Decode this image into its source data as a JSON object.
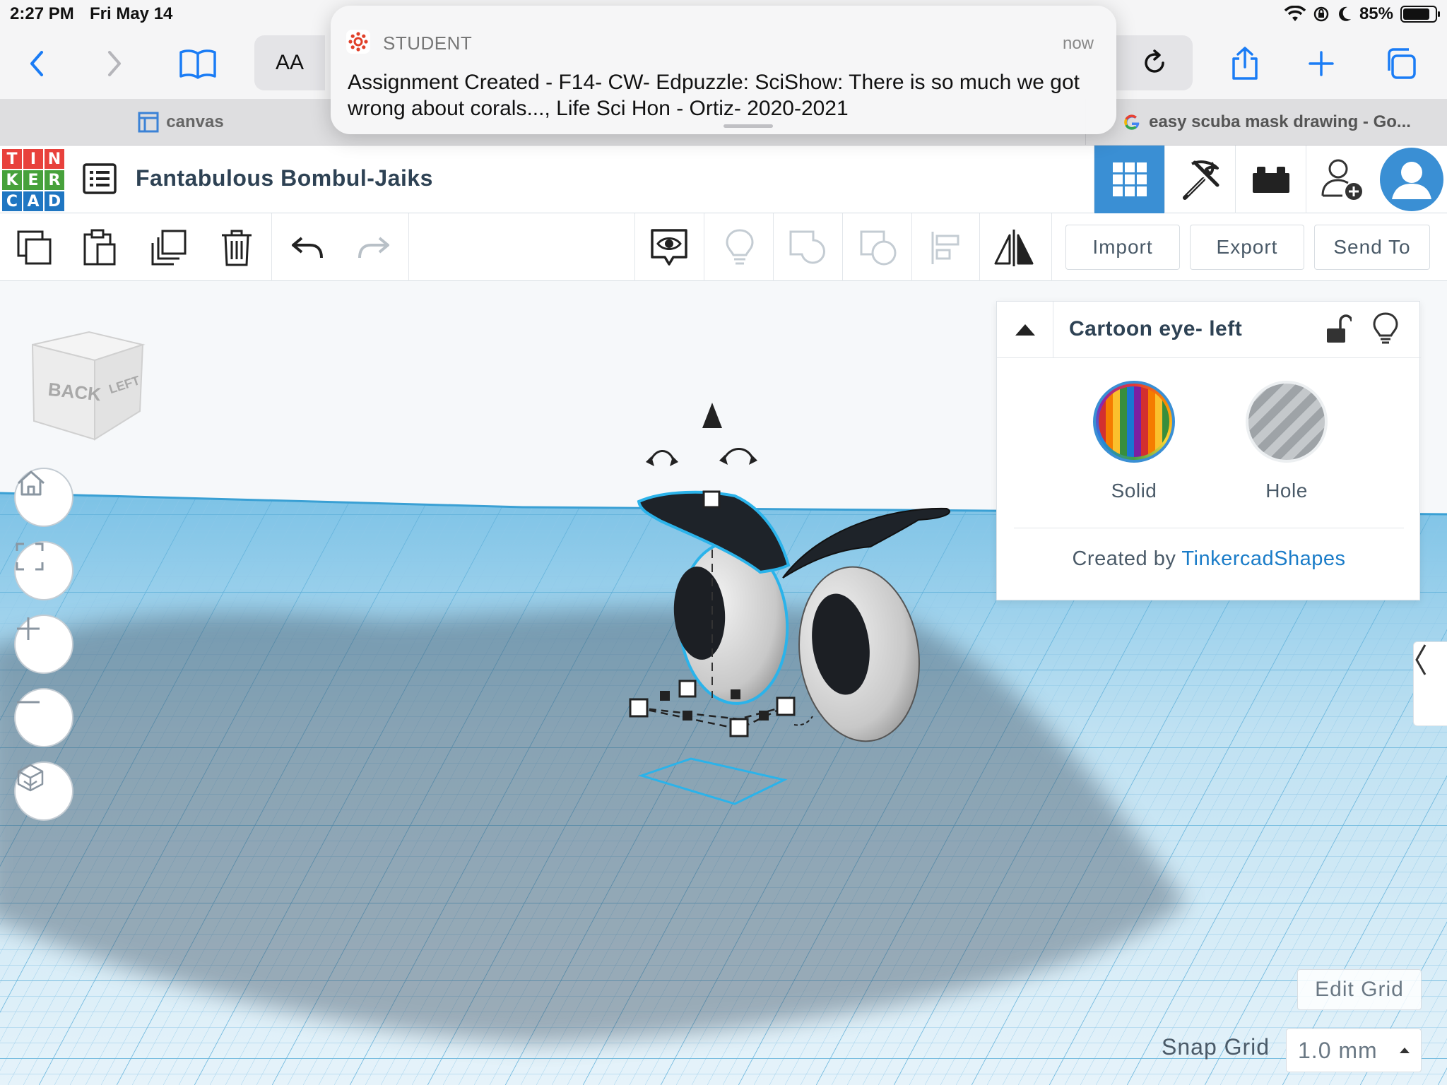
{
  "status_bar": {
    "time": "2:27 PM",
    "date": "Fri May 14",
    "battery": "85%",
    "battery_level": 0.85
  },
  "safari": {
    "reader_label": "AA",
    "tabs": [
      {
        "label": "canvas"
      },
      {
        "label": "easy scuba mask drawing - Go..."
      }
    ]
  },
  "notification": {
    "app": "STUDENT",
    "time": "now",
    "message": "Assignment Created - F14- CW- Edpuzzle: SciShow: There is so much we got wrong about corals..., Life Sci Hon - Ortiz- 2020-2021"
  },
  "tinkercad": {
    "logo_letters": [
      "T",
      "I",
      "N",
      "K",
      "E",
      "R",
      "C",
      "A",
      "D"
    ],
    "logo_colors": [
      "#e8413c",
      "#e8413c",
      "#e8413c",
      "#47a13b",
      "#47a13b",
      "#47a13b",
      "#1f76c2",
      "#1f76c2",
      "#1f76c2"
    ],
    "design_title": "Fantabulous Bombul-Jaiks",
    "toolbar": {
      "import": "Import",
      "export": "Export",
      "send_to": "Send To"
    },
    "viewcube": {
      "front": "BACK",
      "side": "LEFT"
    },
    "inspector": {
      "title": "Cartoon eye- left",
      "solid_label": "Solid",
      "hole_label": "Hole",
      "credit_prefix": "Created by",
      "credit_link": "TinkercadShapes",
      "selected": "Solid"
    },
    "edit_grid": "Edit Grid",
    "snap_grid_label": "Snap Grid",
    "snap_grid_value": "1.0 mm"
  },
  "colors": {
    "accent": "#3a8fd4",
    "ios_blue": "#1a7cf5",
    "selection": "#2bb3ea",
    "grid": "#a9d6ef"
  }
}
